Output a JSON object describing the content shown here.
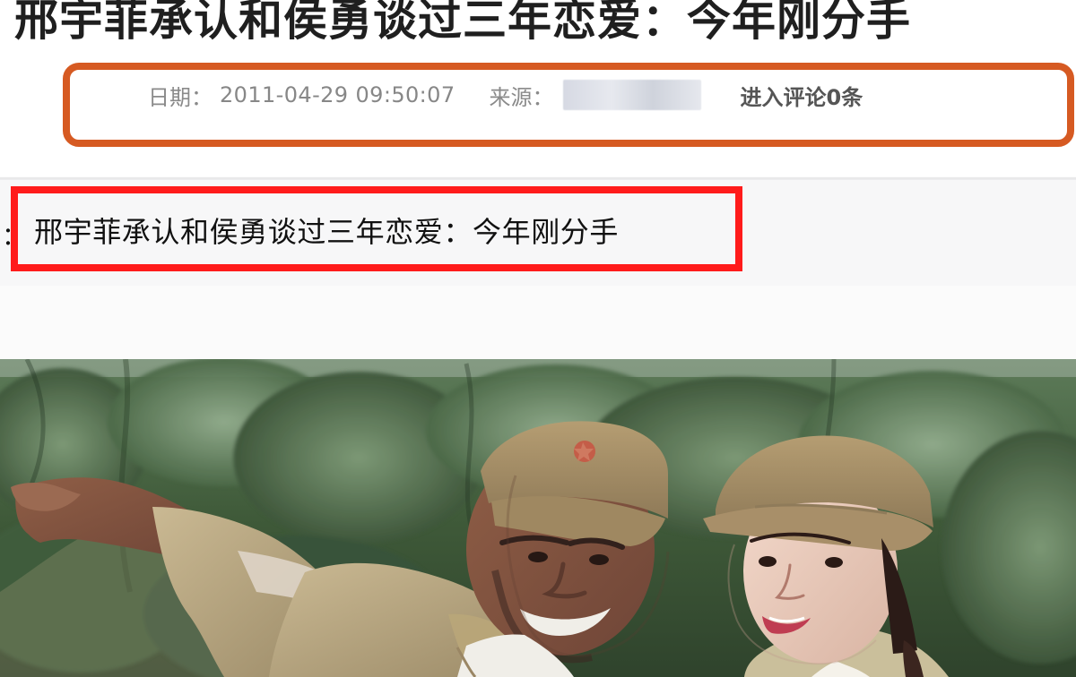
{
  "headline": {
    "title": "邢宇菲承认和侯勇谈过三年恋爱：今年刚分手"
  },
  "meta": {
    "date_label": "日期：",
    "date_value": "2011-04-29 09:50:07",
    "source_label": "来源：",
    "comments_text": "进入评论0条"
  },
  "article": {
    "prefix": "：",
    "title": "邢宇菲承认和侯勇谈过三年恋爱：今年刚分手"
  },
  "colors": {
    "highlight_orange": "#d65a22",
    "highlight_red": "#ff1b1b"
  }
}
